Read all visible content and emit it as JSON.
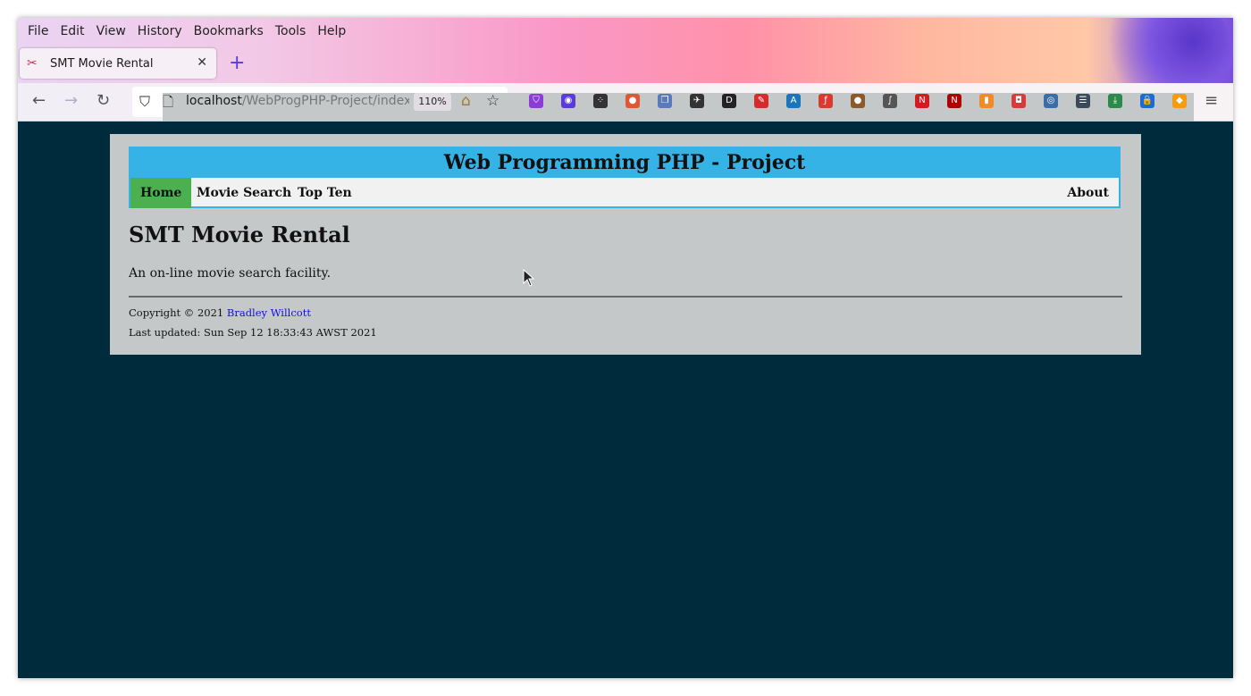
{
  "menubar": {
    "items": [
      "File",
      "Edit",
      "View",
      "History",
      "Bookmarks",
      "Tools",
      "Help"
    ]
  },
  "tab": {
    "title": "SMT Movie Rental",
    "close_glyph": "✕",
    "new_tab_glyph": "+"
  },
  "toolbar": {
    "url_host": "localhost",
    "url_path": "/WebProgPHP-Project/index.",
    "zoom": "110%",
    "extensions": [
      {
        "icon": "pocket-icon",
        "color": "#8b3bd6"
      },
      {
        "icon": "circle-dot-icon",
        "color": "#5b3bd6"
      },
      {
        "icon": "dots-icon",
        "color": "#333333"
      },
      {
        "icon": "duckduckgo-icon",
        "color": "#de5833"
      },
      {
        "icon": "copy-icon",
        "color": "#5a7ab8"
      },
      {
        "icon": "shoe-icon",
        "color": "#333333"
      },
      {
        "icon": "d-icon",
        "color": "#222222"
      },
      {
        "icon": "pen-icon",
        "color": "#d62b2b"
      },
      {
        "icon": "a-icon",
        "color": "#1b75bb"
      },
      {
        "icon": "flash-icon",
        "color": "#d93a2f"
      },
      {
        "icon": "cookie-icon",
        "color": "#8b5a2b"
      },
      {
        "icon": "leaf-icon",
        "color": "#555555"
      },
      {
        "icon": "n-icon",
        "color": "#d71920"
      },
      {
        "icon": "netflix-ext-icon",
        "color": "#b00000"
      },
      {
        "icon": "trash-icon",
        "color": "#f08a2a"
      },
      {
        "icon": "camera-icon",
        "color": "#d83a3a"
      },
      {
        "icon": "mask-icon",
        "color": "#3a6ea5"
      },
      {
        "icon": "list-icon",
        "color": "#3a4a5a"
      },
      {
        "icon": "download-icon",
        "color": "#2a8a4a"
      },
      {
        "icon": "lock-icon",
        "color": "#1a6ad8"
      },
      {
        "icon": "stack-icon",
        "color": "#f39c12"
      }
    ]
  },
  "site": {
    "title": "Web Programming PHP - Project",
    "nav": {
      "home": "Home",
      "movie_search": "Movie Search",
      "top_ten": "Top Ten",
      "about": "About"
    },
    "heading": "SMT Movie Rental",
    "intro": "An on-line movie search facility.",
    "footer": {
      "copyright": "Copyright © 2021 ",
      "author": "Bradley Willcott",
      "last_updated": "Last updated: Sun Sep 12 18:33:43 AWST 2021"
    }
  },
  "colors": {
    "page_background": "#002b3d",
    "container": "#c5c8c9",
    "header_blue": "#36b3e6",
    "nav_active": "#4caf50",
    "link": "#1010e0"
  }
}
